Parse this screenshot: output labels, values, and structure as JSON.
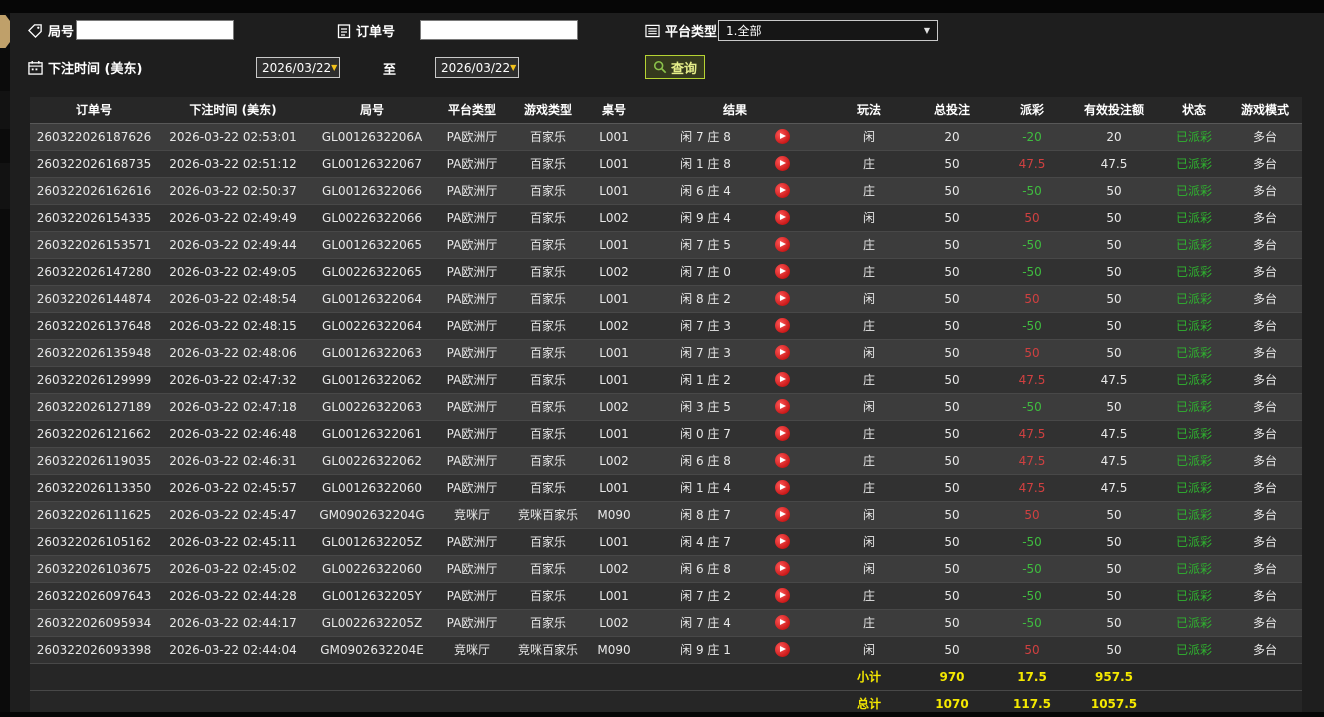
{
  "filters": {
    "round_no_label": "局号",
    "round_no_value": "",
    "order_no_label": "订单号",
    "order_no_value": "",
    "platform_type_label": "平台类型",
    "platform_type_value": "1.全部",
    "bet_time_label": "下注时间 (美东)",
    "date_from": "2026/03/22",
    "to_label": "至",
    "date_to": "2026/03/22",
    "query_label": "查询"
  },
  "table": {
    "headers": [
      "订单号",
      "下注时间 (美东)",
      "局号",
      "平台类型",
      "游戏类型",
      "桌号",
      "结果",
      "玩法",
      "总投注",
      "派彩",
      "有效投注额",
      "状态",
      "游戏模式"
    ],
    "rows": [
      {
        "order_no": "260322026187626",
        "bet_time": "2026-03-22 02:53:01",
        "round_no": "GL0012632206A",
        "platform": "PA欧洲厅",
        "game_type": "百家乐",
        "table_no": "L001",
        "result": "闲 7 庄 8",
        "play_type": "闲",
        "total_bet": "20",
        "payout": "-20",
        "valid_bet": "20",
        "status": "已派彩",
        "mode": "多台"
      },
      {
        "order_no": "260322026168735",
        "bet_time": "2026-03-22 02:51:12",
        "round_no": "GL00126322067",
        "platform": "PA欧洲厅",
        "game_type": "百家乐",
        "table_no": "L001",
        "result": "闲 1 庄 8",
        "play_type": "庄",
        "total_bet": "50",
        "payout": "47.5",
        "valid_bet": "47.5",
        "status": "已派彩",
        "mode": "多台"
      },
      {
        "order_no": "260322026162616",
        "bet_time": "2026-03-22 02:50:37",
        "round_no": "GL00126322066",
        "platform": "PA欧洲厅",
        "game_type": "百家乐",
        "table_no": "L001",
        "result": "闲 6 庄 4",
        "play_type": "庄",
        "total_bet": "50",
        "payout": "-50",
        "valid_bet": "50",
        "status": "已派彩",
        "mode": "多台"
      },
      {
        "order_no": "260322026154335",
        "bet_time": "2026-03-22 02:49:49",
        "round_no": "GL00226322066",
        "platform": "PA欧洲厅",
        "game_type": "百家乐",
        "table_no": "L002",
        "result": "闲 9 庄 4",
        "play_type": "闲",
        "total_bet": "50",
        "payout": "50",
        "valid_bet": "50",
        "status": "已派彩",
        "mode": "多台"
      },
      {
        "order_no": "260322026153571",
        "bet_time": "2026-03-22 02:49:44",
        "round_no": "GL00126322065",
        "platform": "PA欧洲厅",
        "game_type": "百家乐",
        "table_no": "L001",
        "result": "闲 7 庄 5",
        "play_type": "庄",
        "total_bet": "50",
        "payout": "-50",
        "valid_bet": "50",
        "status": "已派彩",
        "mode": "多台"
      },
      {
        "order_no": "260322026147280",
        "bet_time": "2026-03-22 02:49:05",
        "round_no": "GL00226322065",
        "platform": "PA欧洲厅",
        "game_type": "百家乐",
        "table_no": "L002",
        "result": "闲 7 庄 0",
        "play_type": "庄",
        "total_bet": "50",
        "payout": "-50",
        "valid_bet": "50",
        "status": "已派彩",
        "mode": "多台"
      },
      {
        "order_no": "260322026144874",
        "bet_time": "2026-03-22 02:48:54",
        "round_no": "GL00126322064",
        "platform": "PA欧洲厅",
        "game_type": "百家乐",
        "table_no": "L001",
        "result": "闲 8 庄 2",
        "play_type": "闲",
        "total_bet": "50",
        "payout": "50",
        "valid_bet": "50",
        "status": "已派彩",
        "mode": "多台"
      },
      {
        "order_no": "260322026137648",
        "bet_time": "2026-03-22 02:48:15",
        "round_no": "GL00226322064",
        "platform": "PA欧洲厅",
        "game_type": "百家乐",
        "table_no": "L002",
        "result": "闲 7 庄 3",
        "play_type": "庄",
        "total_bet": "50",
        "payout": "-50",
        "valid_bet": "50",
        "status": "已派彩",
        "mode": "多台"
      },
      {
        "order_no": "260322026135948",
        "bet_time": "2026-03-22 02:48:06",
        "round_no": "GL00126322063",
        "platform": "PA欧洲厅",
        "game_type": "百家乐",
        "table_no": "L001",
        "result": "闲 7 庄 3",
        "play_type": "闲",
        "total_bet": "50",
        "payout": "50",
        "valid_bet": "50",
        "status": "已派彩",
        "mode": "多台"
      },
      {
        "order_no": "260322026129999",
        "bet_time": "2026-03-22 02:47:32",
        "round_no": "GL00126322062",
        "platform": "PA欧洲厅",
        "game_type": "百家乐",
        "table_no": "L001",
        "result": "闲 1 庄 2",
        "play_type": "庄",
        "total_bet": "50",
        "payout": "47.5",
        "valid_bet": "47.5",
        "status": "已派彩",
        "mode": "多台"
      },
      {
        "order_no": "260322026127189",
        "bet_time": "2026-03-22 02:47:18",
        "round_no": "GL00226322063",
        "platform": "PA欧洲厅",
        "game_type": "百家乐",
        "table_no": "L002",
        "result": "闲 3 庄 5",
        "play_type": "闲",
        "total_bet": "50",
        "payout": "-50",
        "valid_bet": "50",
        "status": "已派彩",
        "mode": "多台"
      },
      {
        "order_no": "260322026121662",
        "bet_time": "2026-03-22 02:46:48",
        "round_no": "GL00126322061",
        "platform": "PA欧洲厅",
        "game_type": "百家乐",
        "table_no": "L001",
        "result": "闲 0 庄 7",
        "play_type": "庄",
        "total_bet": "50",
        "payout": "47.5",
        "valid_bet": "47.5",
        "status": "已派彩",
        "mode": "多台"
      },
      {
        "order_no": "260322026119035",
        "bet_time": "2026-03-22 02:46:31",
        "round_no": "GL00226322062",
        "platform": "PA欧洲厅",
        "game_type": "百家乐",
        "table_no": "L002",
        "result": "闲 6 庄 8",
        "play_type": "庄",
        "total_bet": "50",
        "payout": "47.5",
        "valid_bet": "47.5",
        "status": "已派彩",
        "mode": "多台"
      },
      {
        "order_no": "260322026113350",
        "bet_time": "2026-03-22 02:45:57",
        "round_no": "GL00126322060",
        "platform": "PA欧洲厅",
        "game_type": "百家乐",
        "table_no": "L001",
        "result": "闲 1 庄 4",
        "play_type": "庄",
        "total_bet": "50",
        "payout": "47.5",
        "valid_bet": "47.5",
        "status": "已派彩",
        "mode": "多台"
      },
      {
        "order_no": "260322026111625",
        "bet_time": "2026-03-22 02:45:47",
        "round_no": "GM0902632204G",
        "platform": "竞咪厅",
        "game_type": "竞咪百家乐",
        "table_no": "M090",
        "result": "闲 8 庄 7",
        "play_type": "闲",
        "total_bet": "50",
        "payout": "50",
        "valid_bet": "50",
        "status": "已派彩",
        "mode": "多台"
      },
      {
        "order_no": "260322026105162",
        "bet_time": "2026-03-22 02:45:11",
        "round_no": "GL0012632205Z",
        "platform": "PA欧洲厅",
        "game_type": "百家乐",
        "table_no": "L001",
        "result": "闲 4 庄 7",
        "play_type": "闲",
        "total_bet": "50",
        "payout": "-50",
        "valid_bet": "50",
        "status": "已派彩",
        "mode": "多台"
      },
      {
        "order_no": "260322026103675",
        "bet_time": "2026-03-22 02:45:02",
        "round_no": "GL00226322060",
        "platform": "PA欧洲厅",
        "game_type": "百家乐",
        "table_no": "L002",
        "result": "闲 6 庄 8",
        "play_type": "闲",
        "total_bet": "50",
        "payout": "-50",
        "valid_bet": "50",
        "status": "已派彩",
        "mode": "多台"
      },
      {
        "order_no": "260322026097643",
        "bet_time": "2026-03-22 02:44:28",
        "round_no": "GL0012632205Y",
        "platform": "PA欧洲厅",
        "game_type": "百家乐",
        "table_no": "L001",
        "result": "闲 7 庄 2",
        "play_type": "庄",
        "total_bet": "50",
        "payout": "-50",
        "valid_bet": "50",
        "status": "已派彩",
        "mode": "多台"
      },
      {
        "order_no": "260322026095934",
        "bet_time": "2026-03-22 02:44:17",
        "round_no": "GL0022632205Z",
        "platform": "PA欧洲厅",
        "game_type": "百家乐",
        "table_no": "L002",
        "result": "闲 7 庄 4",
        "play_type": "庄",
        "total_bet": "50",
        "payout": "-50",
        "valid_bet": "50",
        "status": "已派彩",
        "mode": "多台"
      },
      {
        "order_no": "260322026093398",
        "bet_time": "2026-03-22 02:44:04",
        "round_no": "GM0902632204E",
        "platform": "竞咪厅",
        "game_type": "竞咪百家乐",
        "table_no": "M090",
        "result": "闲 9 庄 1",
        "play_type": "闲",
        "total_bet": "50",
        "payout": "50",
        "valid_bet": "50",
        "status": "已派彩",
        "mode": "多台"
      }
    ],
    "subtotal": {
      "label": "小计",
      "total_bet": "970",
      "payout": "17.5",
      "valid_bet": "957.5"
    },
    "total": {
      "label": "总计",
      "total_bet": "1070",
      "payout": "117.5",
      "valid_bet": "1057.5"
    }
  },
  "colors": {
    "payout_positive": "#d04040",
    "payout_negative": "#3fbc3f",
    "status_paid": "#2fb32f",
    "summary_yellow": "#f5e900",
    "accent_lime": "#b6d433",
    "date_arrow": "#f2c21c",
    "gold_tab": "#bfa06a"
  }
}
